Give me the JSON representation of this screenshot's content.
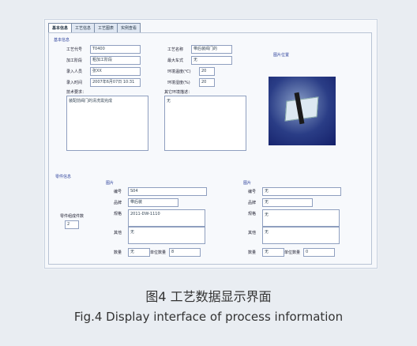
{
  "tabs": [
    "基本信息",
    "工艺信息",
    "工艺图表",
    "实例查看"
  ],
  "section1_title": "基本信息",
  "fields_left": [
    {
      "label": "工艺代号",
      "value": "T0400"
    },
    {
      "label": "加工阶段",
      "value": "粗加工阶段"
    },
    {
      "label": "录入人员",
      "value": "张XX"
    },
    {
      "label": "录入时间",
      "value": "2007年6月07日 10:31"
    }
  ],
  "fields_right": [
    {
      "label": "工艺名称",
      "value": "带后装阀门的"
    },
    {
      "label": "最大车式",
      "value": "无"
    },
    {
      "label": "环境温度(℃)",
      "value": "20"
    },
    {
      "label": "环境湿度(%)",
      "value": "20"
    }
  ],
  "note_left_label": "技术要求：",
  "note_left_value": "装配前阀门的清洗需完成",
  "note_right_label": "其它环境描述：",
  "note_right_value": "无",
  "image_title": "图片位置",
  "section2_title": "零件信息",
  "part_count_label": "零件组成件数",
  "part_count_value": "2",
  "part1": {
    "title": "图片",
    "id_label": "编号",
    "id_value": "S04",
    "name_label": "品牌",
    "name_value": "带后装",
    "spec_label": "规格",
    "spec_value": "2011-DW-1110",
    "other_label": "其他",
    "other_value": "无",
    "qty_label": "数量",
    "qty_value": "无",
    "unit_label": "单位数量",
    "unit_value": "8"
  },
  "part2": {
    "title": "图片",
    "id_label": "编号",
    "id_value": "无",
    "name_label": "品牌",
    "name_value": "无",
    "spec_label": "规格",
    "spec_value": "无",
    "other_label": "其他",
    "other_value": "无",
    "qty_label": "数量",
    "qty_value": "无",
    "unit_label": "单位数量",
    "unit_value": "0"
  },
  "caption_cn": "图4  工艺数据显示界面",
  "caption_en": "Fig.4   Display interface of process information"
}
